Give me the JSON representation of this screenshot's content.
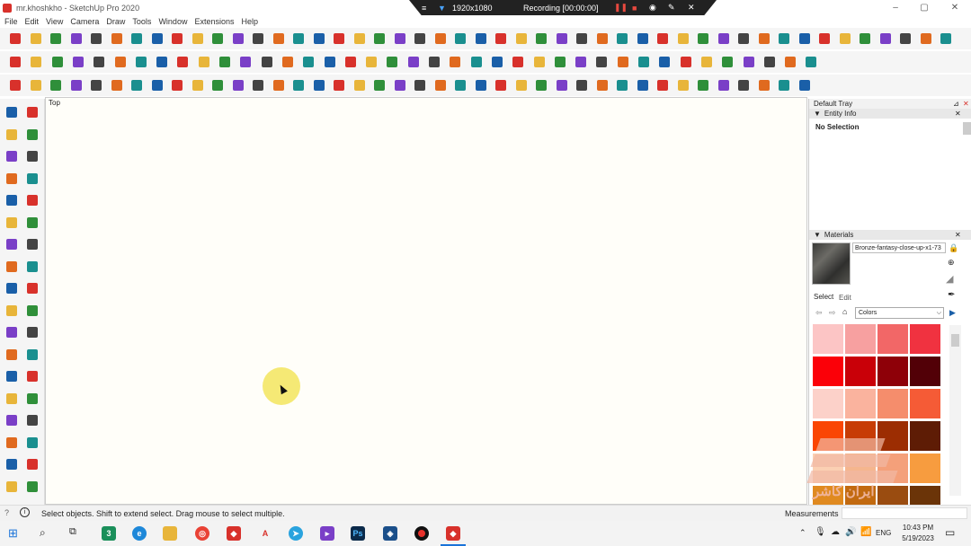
{
  "window": {
    "title": "mr.khoshkho - SketchUp Pro 2020",
    "minimize": "–",
    "maximize": "▢",
    "close": "✕"
  },
  "recorder": {
    "resolution": "1920x1080",
    "status": "Recording [00:00:00]",
    "menu_glyph": "≡",
    "close_glyph": "✕"
  },
  "menu": [
    "File",
    "Edit",
    "View",
    "Camera",
    "Draw",
    "Tools",
    "Window",
    "Extensions",
    "Help"
  ],
  "viewport": {
    "view_name": "Top"
  },
  "tray": {
    "title": "Default Tray",
    "entity_info": {
      "header": "Entity Info",
      "selection": "No Selection"
    },
    "materials": {
      "header": "Materials",
      "material_name": "Bronze-fantasy-close-up-x1-73",
      "tab_select": "Select",
      "tab_edit": "Edit",
      "collection": "Colors"
    },
    "swatches": [
      "#fcc5c5",
      "#f7a0a0",
      "#f26767",
      "#f03240",
      "#fb0008",
      "#c90008",
      "#8e0008",
      "#520007",
      "#fcd1c9",
      "#fab39e",
      "#f58d6c",
      "#f55b36",
      "#fa4604",
      "#c73c05",
      "#9c2d02",
      "#5e1c05",
      "#fbd0b3",
      "#f5b68e",
      "#f4a07a",
      "#f79c3f",
      "#e08a20",
      "#c26a10",
      "#9a4c10",
      "#6b3408"
    ]
  },
  "watermark": {
    "text": "ایران کاشر",
    "color": "#f1b8a4"
  },
  "status": {
    "message": "Select objects. Shift to extend select. Drag mouse to select multiple.",
    "measurements_label": "Measurements",
    "info_glyph": "i",
    "help_glyph": "?"
  },
  "taskbar": {
    "time": "10:43 PM",
    "date": "5/19/2023",
    "lang": "ENG"
  },
  "colors": {
    "accent_red": "#d8312b",
    "toolbar_bg": "#f5f5f5",
    "viewport_bg": "#fffef9"
  }
}
